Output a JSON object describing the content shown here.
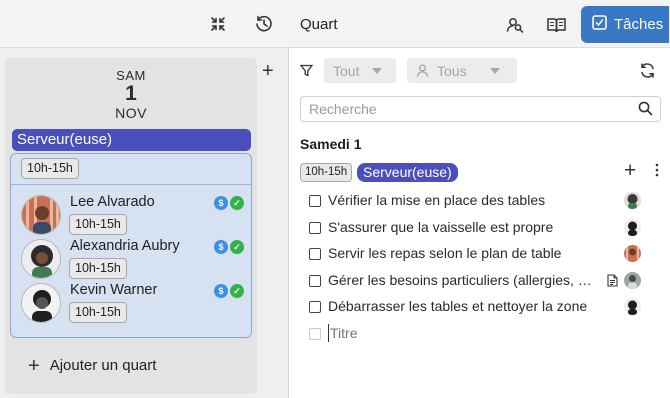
{
  "left_panel": {
    "day": {
      "weekday": "SAM",
      "number": "1",
      "month": "NOV"
    },
    "role": "Serveur(euse)",
    "shift_time": "10h-15h",
    "employees": [
      {
        "name": "Lee Alvarado",
        "time": "10h-15h",
        "avatar_color": "#c96f57"
      },
      {
        "name": "Alexandria Aubry",
        "time": "10h-15h",
        "avatar_color": "#3a3a3a"
      },
      {
        "name": "Kevin Warner",
        "time": "10h-15h",
        "avatar_color": "#2a2a2a"
      }
    ],
    "add_shift_label": "Ajouter un quart"
  },
  "right_panel": {
    "title": "Quart",
    "tasks_button_label": "Tâches",
    "filters": {
      "type": "Tout",
      "people": "Tous"
    },
    "search_placeholder": "Recherche",
    "date_heading": "Samedi 1",
    "shift_time": "10h-15h",
    "role": "Serveur(euse)",
    "tasks": [
      {
        "text": "Vérifier la mise en place des tables",
        "has_note": false,
        "avatar_color": "#3a3a3a"
      },
      {
        "text": "S'assurer que la vaisselle est propre",
        "has_note": false,
        "avatar_color": "#2a2a2a"
      },
      {
        "text": "Servir les repas selon le plan de table",
        "has_note": false,
        "avatar_color": "#c96f57"
      },
      {
        "text": "Gérer les besoins particuliers (allergies, végé...",
        "has_note": true,
        "avatar_color": "#6a6a6a"
      },
      {
        "text": "Débarrasser les tables et nettoyer la zone",
        "has_note": false,
        "avatar_color": "#2a2a2a"
      }
    ],
    "new_task_placeholder": "Titre"
  },
  "colors": {
    "role_purple": "#4b4fbc",
    "tasks_blue": "#3878c4",
    "shift_bg": "#d6e2f1",
    "pay_badge": "#3d8ee6",
    "ok_badge": "#33b24a"
  },
  "icons": {
    "collapse": "collapse-arrows-icon",
    "history": "clock-history-icon",
    "add_day": "plus-icon",
    "pay": "dollar-icon",
    "approved": "check-icon",
    "people_search": "people-search-icon",
    "book": "book-icon",
    "tasks": "checkbox-icon",
    "filter": "filter-icon",
    "refresh": "refresh-icon",
    "search": "search-icon",
    "more": "more-vertical-icon",
    "note": "document-icon"
  }
}
